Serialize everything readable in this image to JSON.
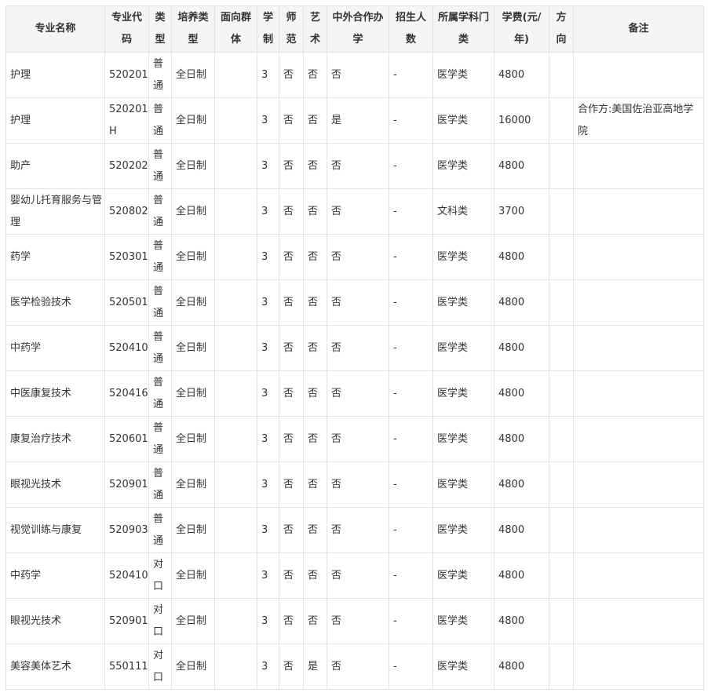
{
  "headers": [
    "专业名称",
    "专业代码",
    "类型",
    "培养类型",
    "面向群体",
    "学制",
    "师范",
    "艺术",
    "中外合作办学",
    "招生人数",
    "所属学科门类",
    "学费(元/年)",
    "方向",
    "备注"
  ],
  "rows": [
    [
      "护理",
      "520201",
      "普通",
      "全日制",
      "",
      "3",
      "否",
      "否",
      "否",
      "-",
      "医学类",
      "4800",
      "",
      ""
    ],
    [
      "护理",
      "520201H",
      "普通",
      "全日制",
      "",
      "3",
      "否",
      "否",
      "是",
      "-",
      "医学类",
      "16000",
      "",
      "合作方:美国佐治亚高地学院"
    ],
    [
      "助产",
      "520202",
      "普通",
      "全日制",
      "",
      "3",
      "否",
      "否",
      "否",
      "-",
      "医学类",
      "4800",
      "",
      ""
    ],
    [
      "婴幼儿托育服务与管理",
      "520802",
      "普通",
      "全日制",
      "",
      "3",
      "否",
      "否",
      "否",
      "-",
      "文科类",
      "3700",
      "",
      ""
    ],
    [
      "药学",
      "520301",
      "普通",
      "全日制",
      "",
      "3",
      "否",
      "否",
      "否",
      "-",
      "医学类",
      "4800",
      "",
      ""
    ],
    [
      "医学检验技术",
      "520501",
      "普通",
      "全日制",
      "",
      "3",
      "否",
      "否",
      "否",
      "-",
      "医学类",
      "4800",
      "",
      ""
    ],
    [
      "中药学",
      "520410",
      "普通",
      "全日制",
      "",
      "3",
      "否",
      "否",
      "否",
      "-",
      "医学类",
      "4800",
      "",
      ""
    ],
    [
      "中医康复技术",
      "520416",
      "普通",
      "全日制",
      "",
      "3",
      "否",
      "否",
      "否",
      "-",
      "医学类",
      "4800",
      "",
      ""
    ],
    [
      "康复治疗技术",
      "520601",
      "普通",
      "全日制",
      "",
      "3",
      "否",
      "否",
      "否",
      "-",
      "医学类",
      "4800",
      "",
      ""
    ],
    [
      "眼视光技术",
      "520901",
      "普通",
      "全日制",
      "",
      "3",
      "否",
      "否",
      "否",
      "-",
      "医学类",
      "4800",
      "",
      ""
    ],
    [
      "视觉训练与康复",
      "520903",
      "普通",
      "全日制",
      "",
      "3",
      "否",
      "否",
      "否",
      "-",
      "医学类",
      "4800",
      "",
      ""
    ],
    [
      "中药学",
      "520410",
      "对口",
      "全日制",
      "",
      "3",
      "否",
      "否",
      "否",
      "-",
      "医学类",
      "4800",
      "",
      ""
    ],
    [
      "眼视光技术",
      "520901",
      "对口",
      "全日制",
      "",
      "3",
      "否",
      "否",
      "否",
      "-",
      "医学类",
      "4800",
      "",
      ""
    ],
    [
      "美容美体艺术",
      "550111",
      "对口",
      "全日制",
      "",
      "3",
      "否",
      "是",
      "否",
      "-",
      "医学类",
      "4800",
      "",
      ""
    ]
  ]
}
